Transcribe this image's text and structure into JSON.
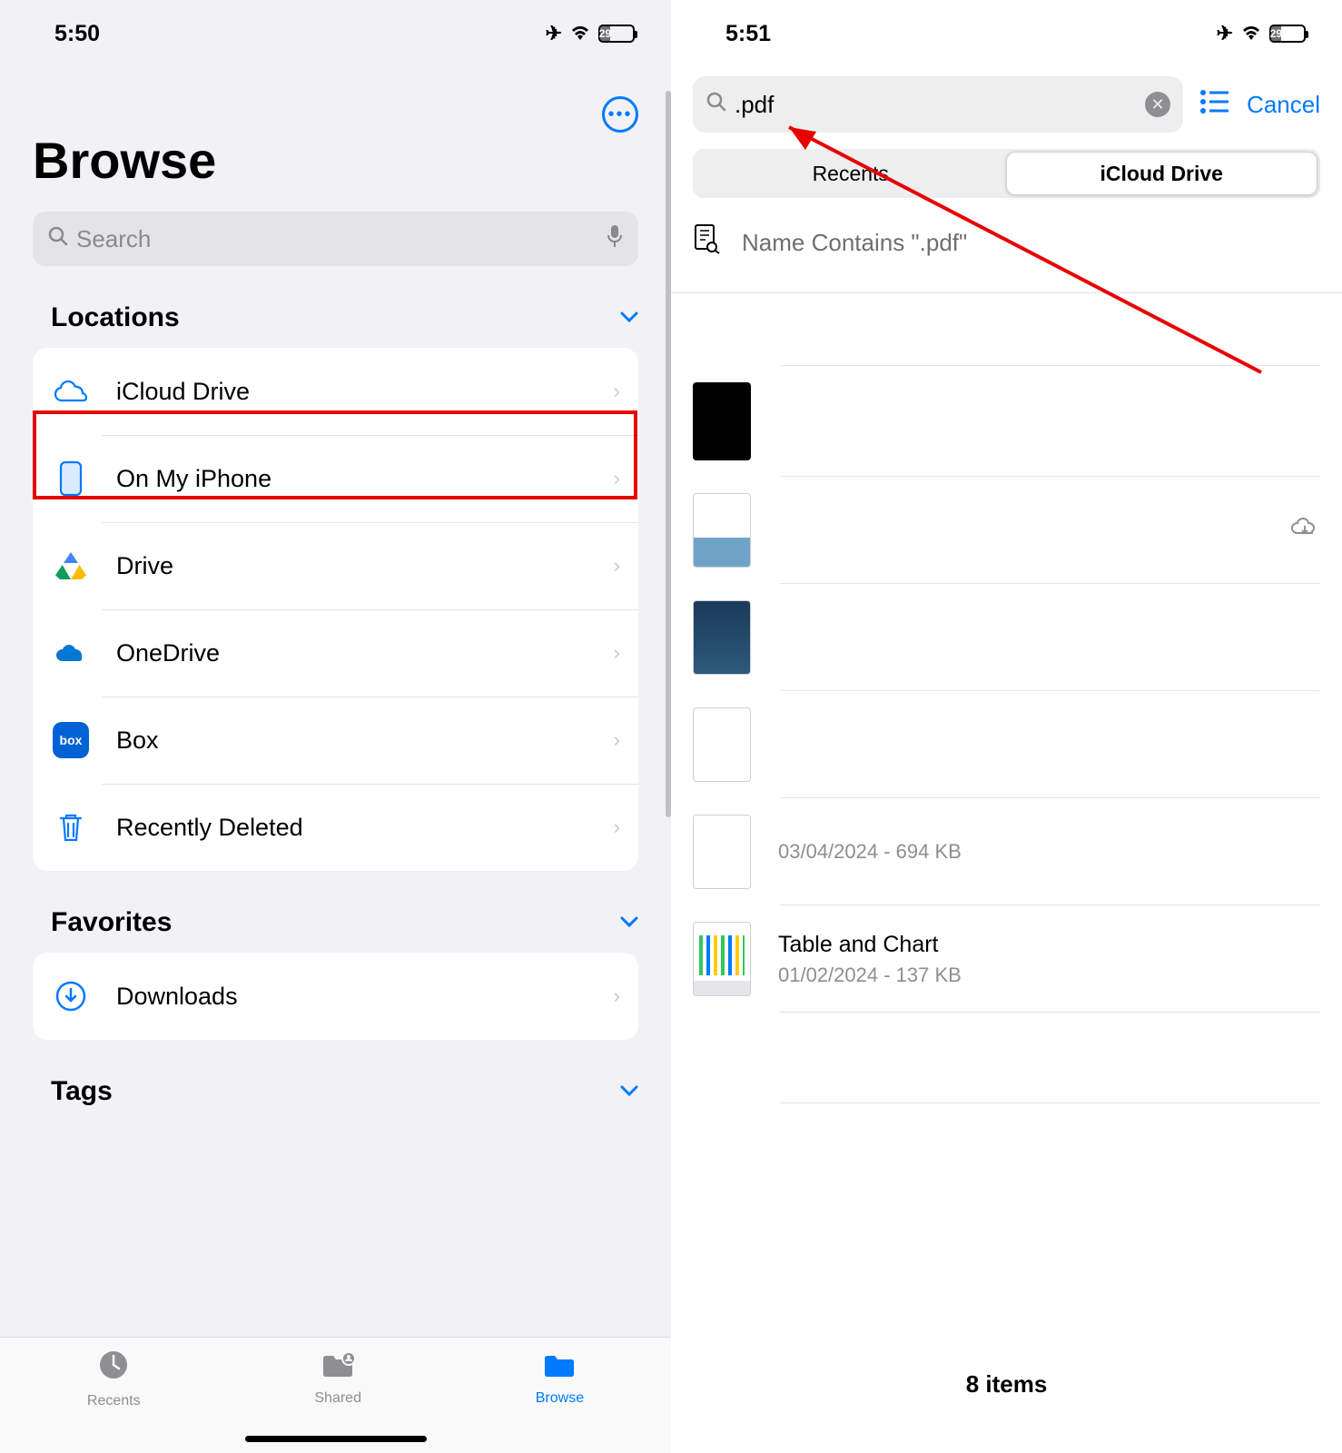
{
  "left": {
    "status_time": "5:50",
    "battery_pct": "29",
    "title": "Browse",
    "search_placeholder": "Search",
    "locations_header": "Locations",
    "locations": [
      {
        "label": "iCloud Drive"
      },
      {
        "label": "On My iPhone"
      },
      {
        "label": "Drive"
      },
      {
        "label": "OneDrive"
      },
      {
        "label": "Box"
      },
      {
        "label": "Recently Deleted"
      }
    ],
    "favorites_header": "Favorites",
    "favorites": [
      {
        "label": "Downloads"
      }
    ],
    "tags_header": "Tags",
    "tabs": {
      "recents": "Recents",
      "shared": "Shared",
      "browse": "Browse"
    }
  },
  "right": {
    "status_time": "5:51",
    "battery_pct": "29",
    "search_value": ".pdf",
    "cancel": "Cancel",
    "segments": {
      "recents": "Recents",
      "icloud": "iCloud Drive"
    },
    "suggestion_text": "Name Contains \".pdf\"",
    "results": [
      {
        "name": "",
        "sub": ""
      },
      {
        "name": "",
        "sub": ""
      },
      {
        "name": "",
        "sub": ""
      },
      {
        "name": "",
        "sub": ""
      },
      {
        "name": "",
        "sub": "03/04/2024 - 694 KB"
      },
      {
        "name": "Table and Chart",
        "sub": "01/02/2024 - 137 KB"
      }
    ],
    "footer": "8 items"
  }
}
